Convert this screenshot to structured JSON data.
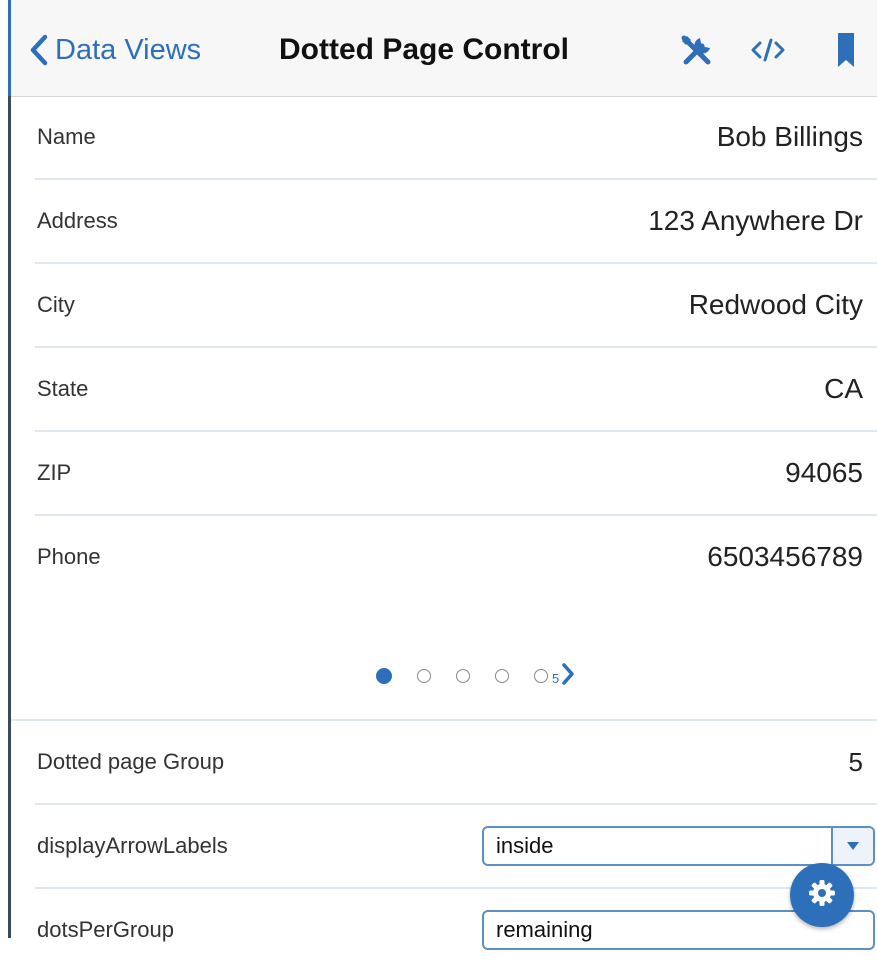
{
  "header": {
    "back_label": "Data Views",
    "title": "Dotted Page Control",
    "icons": [
      "wrench-screwdriver-icon",
      "code-icon",
      "bookmark-icon"
    ]
  },
  "fields": [
    {
      "label": "Name",
      "value": "Bob Billings"
    },
    {
      "label": "Address",
      "value": "123 Anywhere Dr"
    },
    {
      "label": "City",
      "value": "Redwood City"
    },
    {
      "label": "State",
      "value": "CA"
    },
    {
      "label": "ZIP",
      "value": "94065"
    },
    {
      "label": "Phone",
      "value": "6503456789"
    }
  ],
  "pager": {
    "dots": 5,
    "active_index": 1,
    "count_label": "5"
  },
  "settings": {
    "group_label": "Dotted page Group",
    "group_value": "5",
    "arrow_labels_label": "displayArrowLabels",
    "arrow_labels_value": "inside",
    "dots_per_group_label": "dotsPerGroup",
    "dots_per_group_value": "remaining"
  },
  "colors": {
    "accent": "#2e6fb9",
    "divider": "#dfe7ef",
    "header_bg": "#f7f7f7"
  }
}
